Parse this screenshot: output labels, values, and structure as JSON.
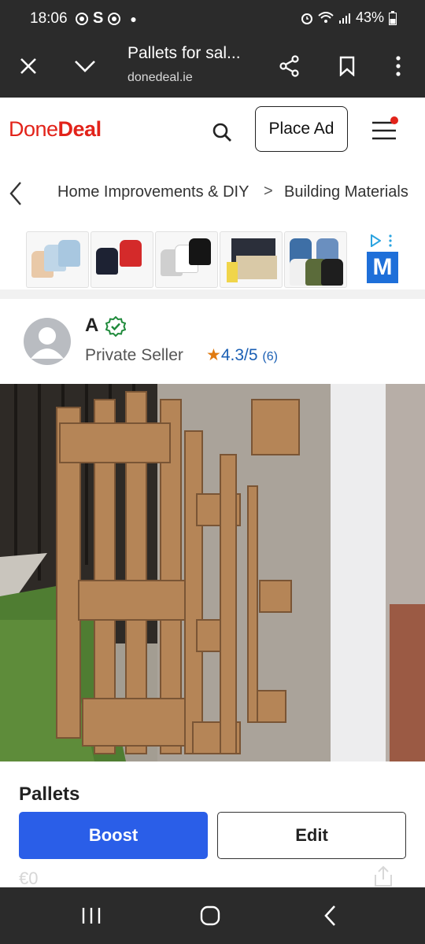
{
  "status_bar": {
    "time": "18:06",
    "battery": "43%"
  },
  "browser": {
    "page_title": "Pallets for sal...",
    "url": "donedeal.ie"
  },
  "site_header": {
    "logo_part1": "Done",
    "logo_part2": "Deal",
    "place_ad_label": "Place Ad",
    "brand_color": "#e2231a"
  },
  "breadcrumb": {
    "items": [
      "Home Improvements & DIY",
      "Building Materials"
    ],
    "separator": ">"
  },
  "ad_banner": {
    "thumb_count": 5,
    "advertiser_logo_letter": "M"
  },
  "seller": {
    "name": "A",
    "type": "Private Seller",
    "rating_star": "★",
    "rating": "4.3/5",
    "review_count": "(6)"
  },
  "listing": {
    "title": "Pallets",
    "boost_label": "Boost",
    "edit_label": "Edit",
    "price": "€0",
    "accent_color": "#2a5ee8"
  }
}
